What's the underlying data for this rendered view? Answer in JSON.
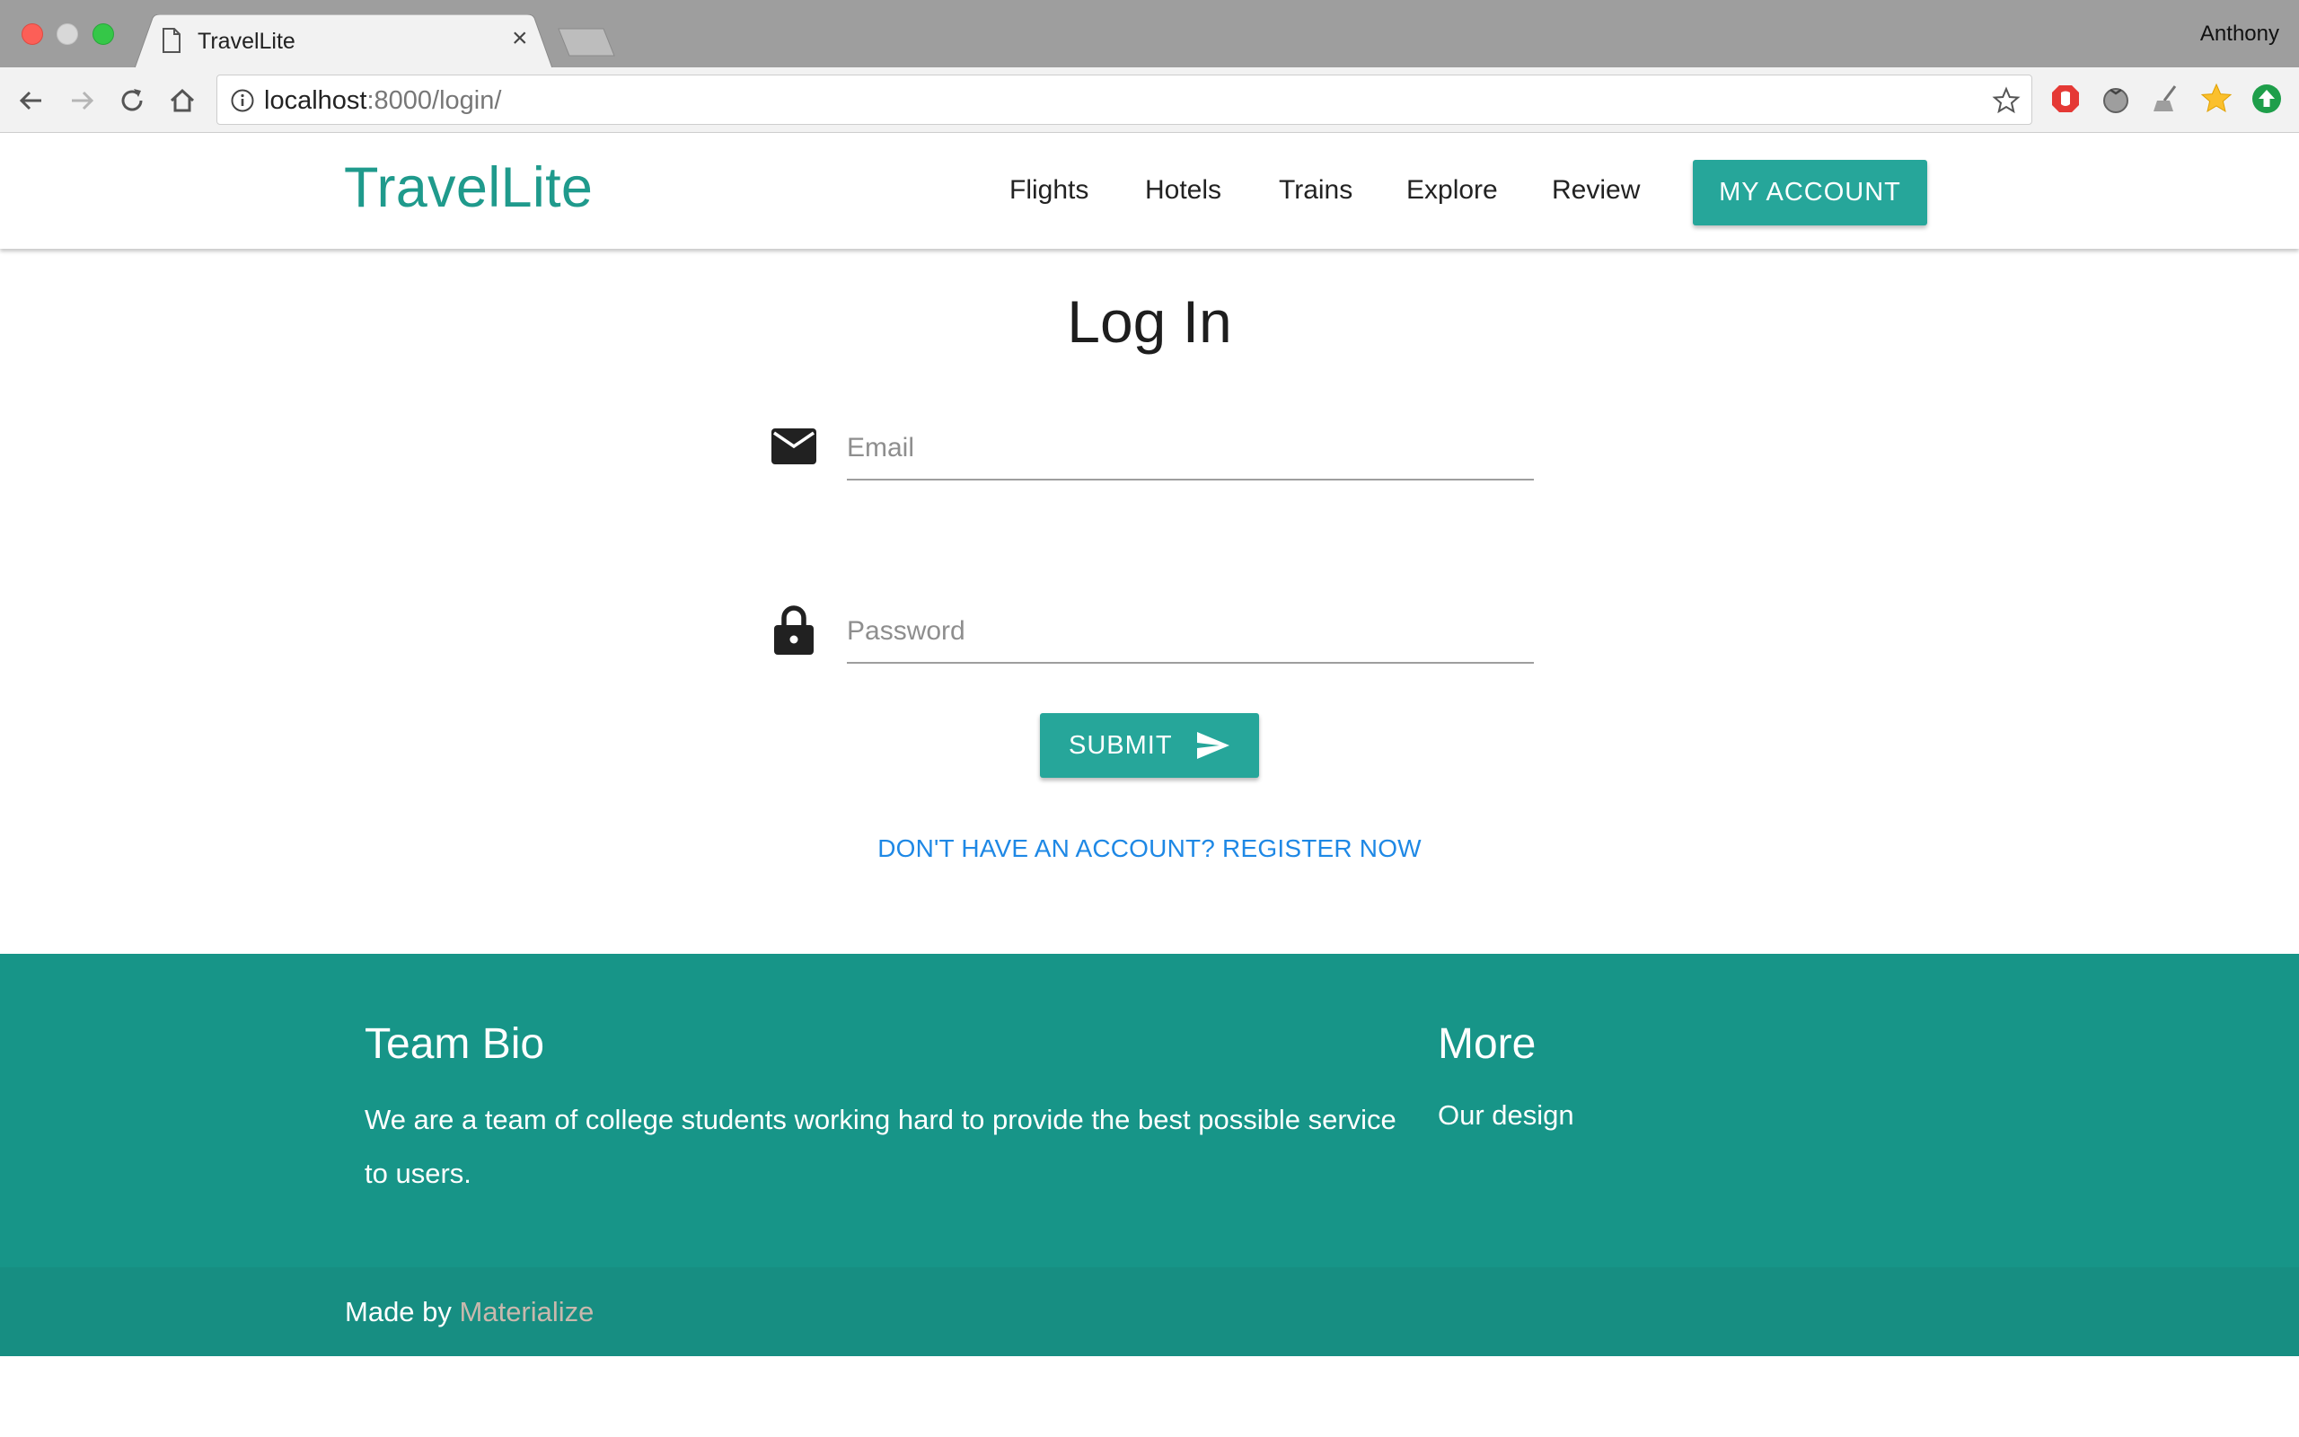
{
  "browser": {
    "tab_title": "TravelLite",
    "tab_close": "×",
    "profile_name": "Anthony",
    "url_host": "localhost",
    "url_path": ":8000/login/"
  },
  "navbar": {
    "brand": "TravelLite",
    "links": [
      "Flights",
      "Hotels",
      "Trains",
      "Explore",
      "Review"
    ],
    "account_button": "MY ACCOUNT"
  },
  "login": {
    "title": "Log In",
    "email_placeholder": "Email",
    "email_value": "",
    "password_placeholder": "Password",
    "password_value": "",
    "submit_label": "SUBMIT",
    "register_link": "DON'T HAVE AN ACCOUNT? REGISTER NOW"
  },
  "footer": {
    "bio_title": "Team Bio",
    "bio_text": "We are a team of college students working hard to provide the best possible service to users.",
    "more_title": "More",
    "more_link": "Our design",
    "made_by_prefix": "Made by ",
    "made_by_link": "Materialize"
  },
  "icons": {
    "email": "mail-icon",
    "password": "lock-icon",
    "submit": "send-icon"
  },
  "colors": {
    "brand": "#1f9a8c",
    "primary_button": "#26a69a",
    "footer": "#179588",
    "footer_copyright": "#178e82",
    "link": "#1e88e5"
  }
}
